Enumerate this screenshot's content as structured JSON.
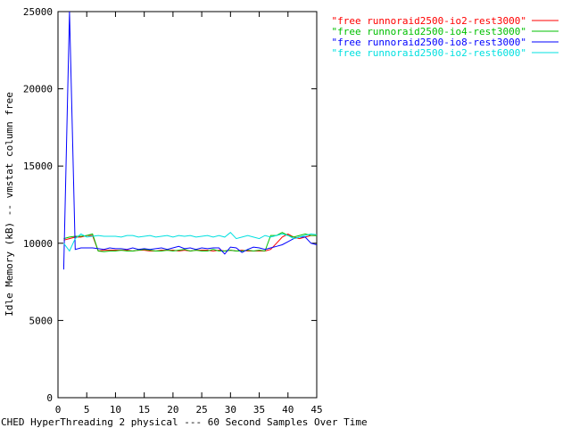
{
  "chart_data": {
    "type": "line",
    "title": "",
    "xlabel": "CHED HyperThreading 2 physical --- 60 Second Samples Over Time",
    "ylabel": "Idle Memory (kB) -- vmstat column free",
    "xlim": [
      0,
      45
    ],
    "ylim": [
      0,
      25000
    ],
    "xticks": [
      0,
      5,
      10,
      15,
      20,
      25,
      30,
      35,
      40,
      45
    ],
    "yticks": [
      0,
      5000,
      10000,
      15000,
      20000,
      25000
    ],
    "grid": false,
    "legend_position": "right-outside",
    "series": [
      {
        "name": "\"free runnoraid2500-io2-rest3000\"",
        "color": "#ff0000",
        "x": [
          1,
          2,
          3,
          4,
          5,
          6,
          7,
          8,
          9,
          10,
          11,
          12,
          13,
          14,
          15,
          16,
          17,
          18,
          19,
          20,
          21,
          22,
          23,
          24,
          25,
          26,
          27,
          28,
          29,
          30,
          31,
          32,
          33,
          34,
          35,
          36,
          37,
          38,
          39,
          40,
          41,
          42,
          43,
          44,
          45
        ],
        "y": [
          10200,
          10300,
          10400,
          10400,
          10500,
          10500,
          9500,
          9550,
          9550,
          9550,
          9550,
          9550,
          9500,
          9550,
          9550,
          9500,
          9500,
          9550,
          9550,
          9550,
          9500,
          9550,
          9500,
          9550,
          9550,
          9550,
          9500,
          9550,
          9500,
          9550,
          9500,
          9550,
          9500,
          9500,
          9500,
          9500,
          9600,
          10000,
          10400,
          10600,
          10400,
          10300,
          10400,
          10500,
          10500
        ]
      },
      {
        "name": "\"free runnoraid2500-io4-rest3000\"",
        "color": "#00c000",
        "x": [
          1,
          2,
          3,
          4,
          5,
          6,
          7,
          8,
          9,
          10,
          11,
          12,
          13,
          14,
          15,
          16,
          17,
          18,
          19,
          20,
          21,
          22,
          23,
          24,
          25,
          26,
          27,
          28,
          29,
          30,
          31,
          32,
          33,
          34,
          35,
          36,
          37,
          38,
          39,
          40,
          41,
          42,
          43,
          44,
          45
        ],
        "y": [
          10300,
          10400,
          10450,
          10450,
          10500,
          10600,
          9500,
          9450,
          9500,
          9500,
          9550,
          9500,
          9500,
          9550,
          9600,
          9550,
          9500,
          9500,
          9550,
          9500,
          9550,
          9600,
          9500,
          9550,
          9500,
          9500,
          9600,
          9500,
          9500,
          9550,
          9500,
          9500,
          9550,
          9500,
          9550,
          9500,
          10500,
          10500,
          10700,
          10500,
          10400,
          10500,
          10600,
          10500,
          10500
        ]
      },
      {
        "name": "\"free runnoraid2500-io8-rest3000\"",
        "color": "#0000ff",
        "x": [
          1,
          2,
          3,
          4,
          5,
          6,
          7,
          8,
          9,
          10,
          11,
          12,
          13,
          14,
          15,
          16,
          17,
          18,
          19,
          20,
          21,
          22,
          23,
          24,
          25,
          26,
          27,
          28,
          29,
          30,
          31,
          32,
          33,
          34,
          35,
          36,
          37,
          38,
          39,
          40,
          41,
          42,
          43,
          44,
          45
        ],
        "y": [
          8300,
          25000,
          9600,
          9700,
          9700,
          9700,
          9650,
          9600,
          9700,
          9650,
          9650,
          9600,
          9700,
          9600,
          9650,
          9600,
          9650,
          9700,
          9600,
          9700,
          9800,
          9650,
          9700,
          9600,
          9700,
          9650,
          9700,
          9700,
          9300,
          9750,
          9700,
          9400,
          9600,
          9750,
          9700,
          9600,
          9700,
          9800,
          9900,
          10100,
          10300,
          10400,
          10400,
          10000,
          9900
        ]
      },
      {
        "name": "\"free runnoraid2500-io2-rest6000\"",
        "color": "#00e0e0",
        "x": [
          1,
          2,
          3,
          4,
          5,
          6,
          7,
          8,
          9,
          10,
          11,
          12,
          13,
          14,
          15,
          16,
          17,
          18,
          19,
          20,
          21,
          22,
          23,
          24,
          25,
          26,
          27,
          28,
          29,
          30,
          31,
          32,
          33,
          34,
          35,
          36,
          37,
          38,
          39,
          40,
          41,
          42,
          43,
          44,
          45
        ],
        "y": [
          10000,
          9500,
          10300,
          10600,
          10400,
          10450,
          10500,
          10450,
          10450,
          10450,
          10400,
          10500,
          10500,
          10400,
          10450,
          10500,
          10400,
          10450,
          10500,
          10400,
          10500,
          10450,
          10500,
          10400,
          10450,
          10500,
          10400,
          10500,
          10400,
          10700,
          10300,
          10400,
          10500,
          10400,
          10300,
          10500,
          10400,
          10500,
          10600,
          10500,
          10300,
          10400,
          10500,
          10600,
          10550
        ]
      }
    ]
  }
}
